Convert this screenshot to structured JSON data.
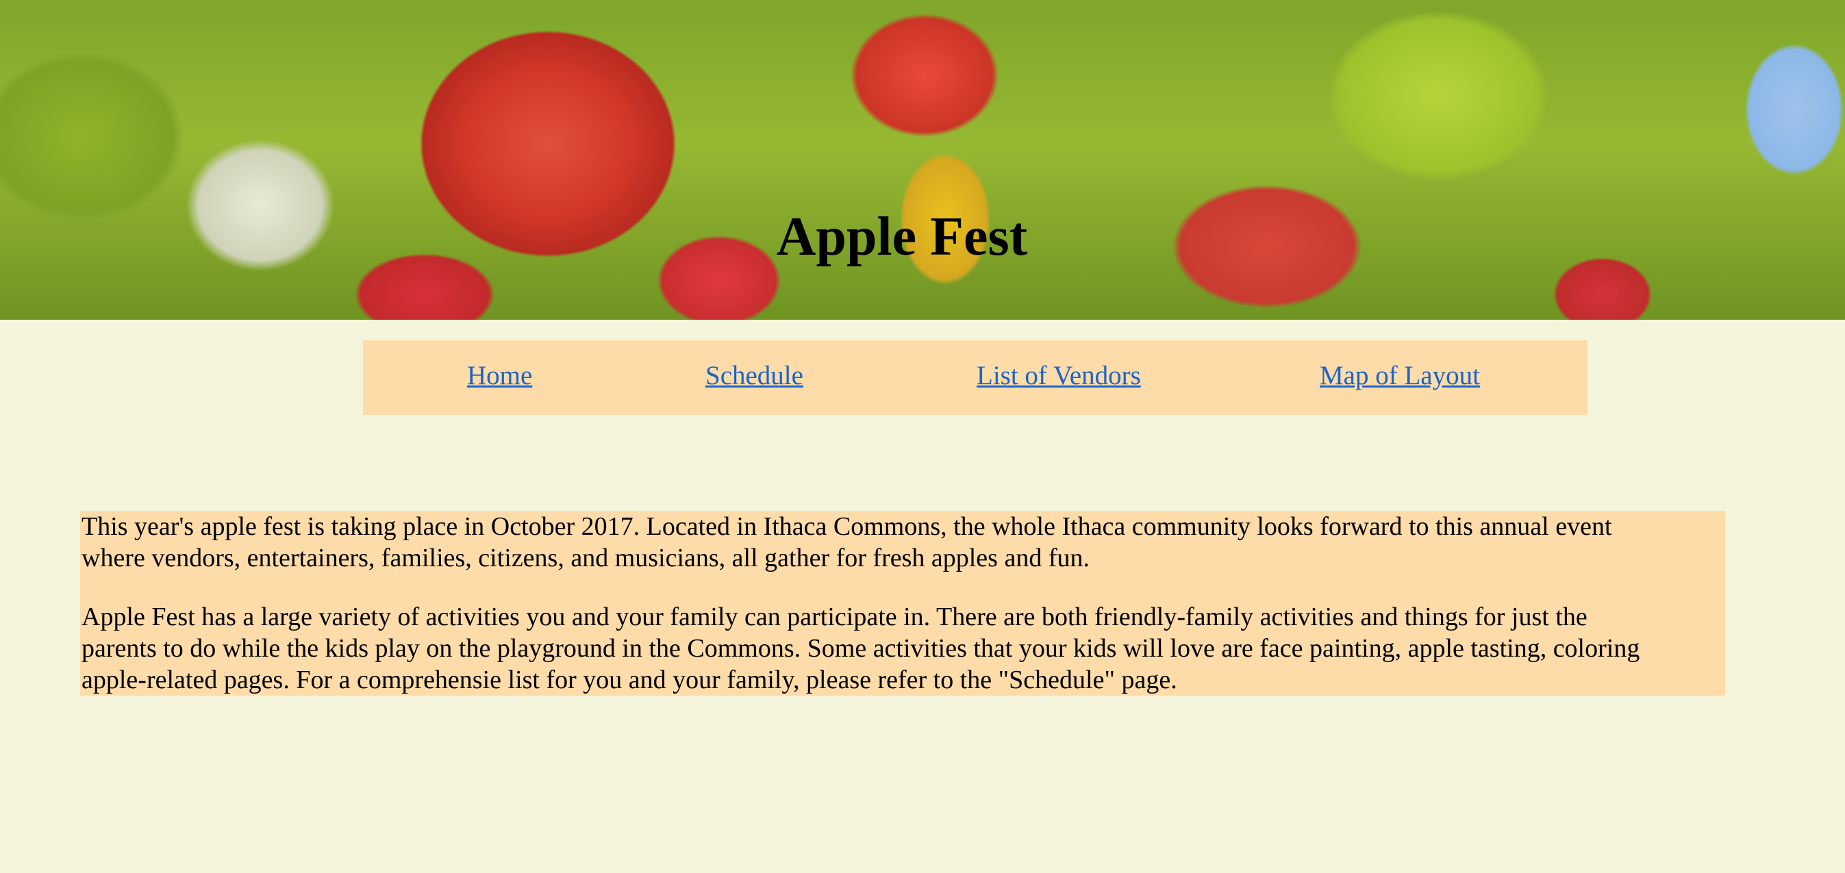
{
  "header": {
    "title": "Apple Fest"
  },
  "nav": {
    "items": [
      {
        "label": "Home"
      },
      {
        "label": "Schedule"
      },
      {
        "label": "List of Vendors"
      },
      {
        "label": "Map of Layout"
      }
    ]
  },
  "content": {
    "paragraph1": [
      "This year's apple fest is taking place in October 2017. Located in Ithaca Commons, the whole Ithaca community looks forward to this annual event",
      "where vendors, entertainers, families, citizens, and musicians, all gather for fresh apples and fun."
    ],
    "paragraph2": [
      "Apple Fest has a large variety of activities you and your family can participate in. There are both friendly-family activities and things for just the",
      "parents to do while the kids play on the playground in the Commons. Some activities that your kids will love are face painting, apple tasting, coloring",
      "apple-related pages. For a comprehensie list for you and your family, please refer to the \"Schedule\" page."
    ]
  },
  "colors": {
    "page_background": "#f5f5dc",
    "nav_background": "#fedcaa",
    "content_background": "#fedcaa",
    "link": "#1a64c8"
  }
}
